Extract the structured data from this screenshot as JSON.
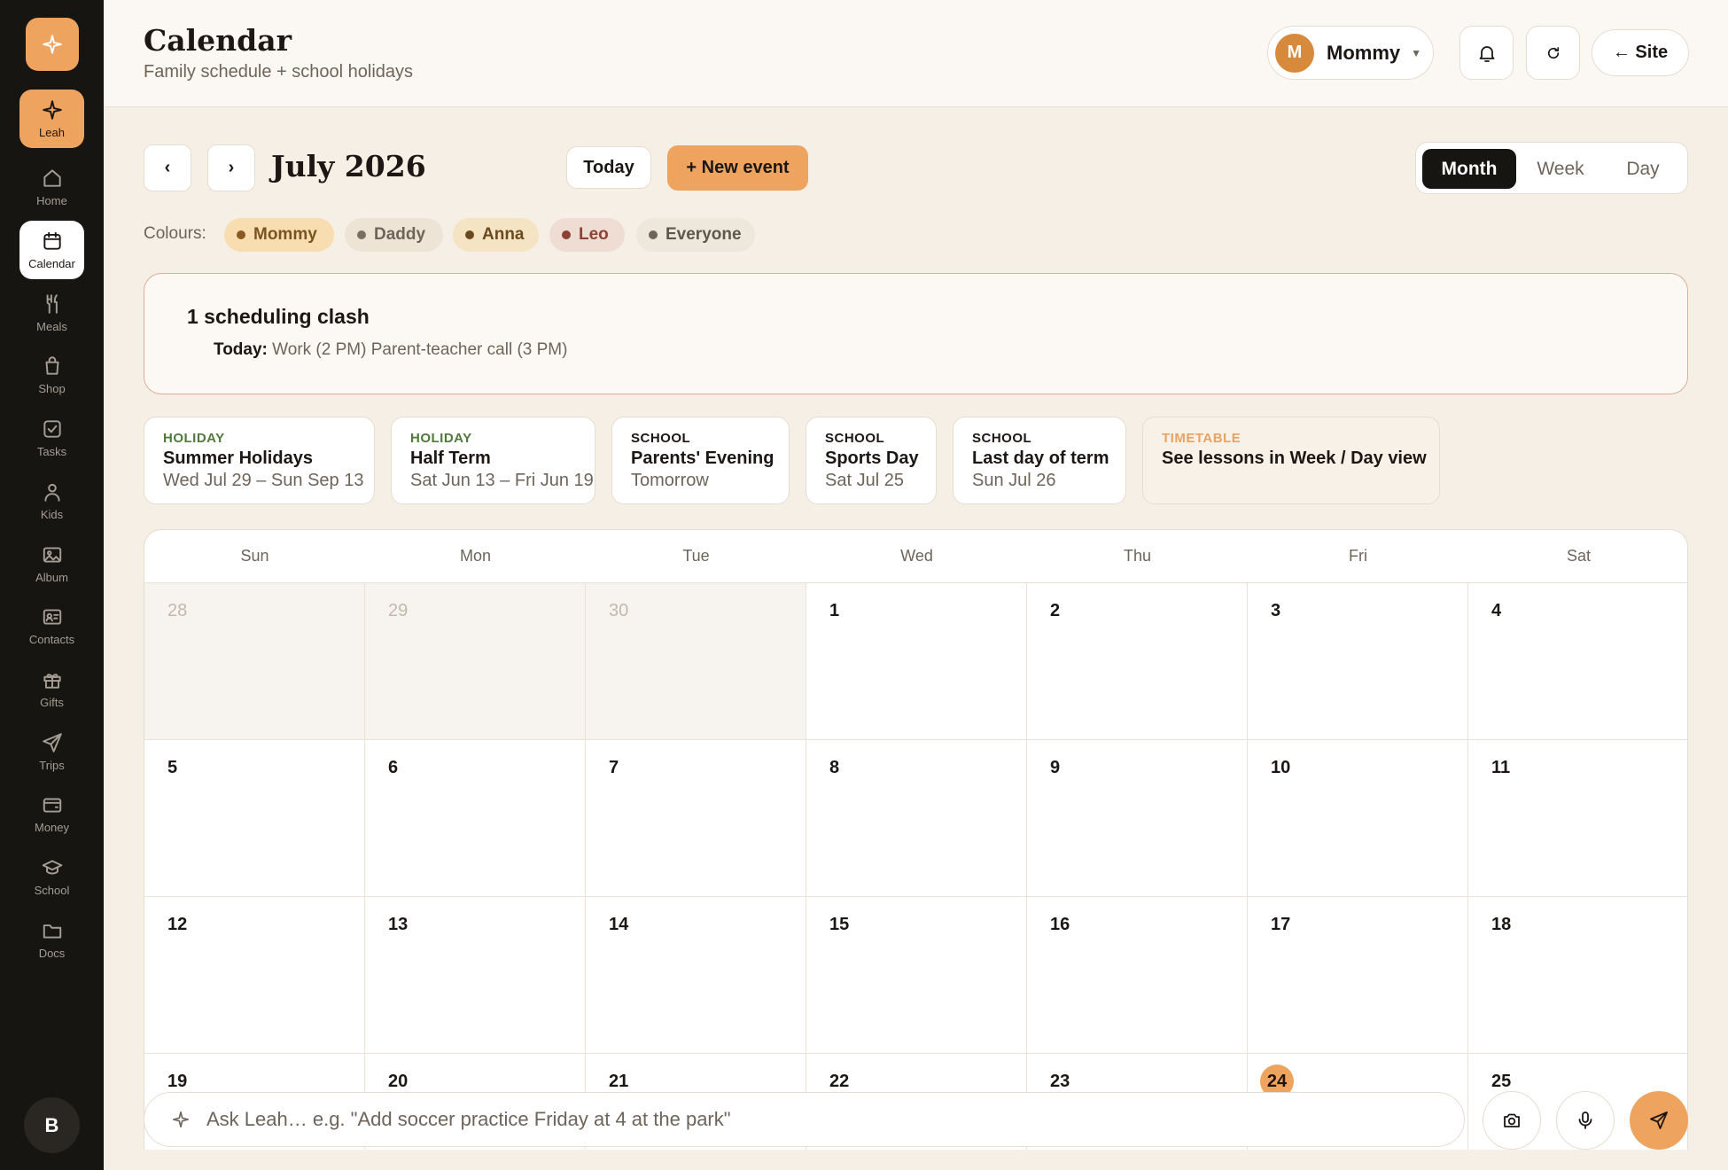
{
  "sidebar": {
    "items": [
      {
        "label": "Leah",
        "icon": "sparkle-icon"
      },
      {
        "label": "Home",
        "icon": "home-icon"
      },
      {
        "label": "Calendar",
        "icon": "calendar-icon"
      },
      {
        "label": "Meals",
        "icon": "utensils-icon"
      },
      {
        "label": "Shop",
        "icon": "shopping-bag-icon"
      },
      {
        "label": "Tasks",
        "icon": "checkbox-icon"
      },
      {
        "label": "Kids",
        "icon": "person-icon"
      },
      {
        "label": "Album",
        "icon": "image-icon"
      },
      {
        "label": "Contacts",
        "icon": "contact-card-icon"
      },
      {
        "label": "Gifts",
        "icon": "gift-icon"
      },
      {
        "label": "Trips",
        "icon": "paper-plane-icon"
      },
      {
        "label": "Money",
        "icon": "wallet-icon"
      },
      {
        "label": "School",
        "icon": "graduation-cap-icon"
      },
      {
        "label": "Docs",
        "icon": "folder-icon"
      }
    ],
    "avatar_initial": "B"
  },
  "header": {
    "title": "Calendar",
    "subtitle": "Family schedule + school holidays",
    "user_initial": "M",
    "user_name": "Mommy",
    "site_label": "← Site"
  },
  "toolbar": {
    "prev": "‹",
    "next": "›",
    "month_label": "July 2026",
    "today_label": "Today",
    "new_event_label": "+ New event",
    "views": [
      "Month",
      "Week",
      "Day"
    ],
    "active_view": "Month"
  },
  "legend": {
    "label": "Colours:",
    "chips": [
      {
        "name": "Mommy",
        "bg": "#f7ddb0",
        "dot": "#8a5a22",
        "color": "#7a5420"
      },
      {
        "name": "Daddy",
        "bg": "#eee4d6",
        "dot": "#7a7064",
        "color": "#6e645a"
      },
      {
        "name": "Anna",
        "bg": "#f4e4c4",
        "dot": "#6b4a1f",
        "color": "#6b4a1f"
      },
      {
        "name": "Leo",
        "bg": "#efdcd3",
        "dot": "#8a4336",
        "color": "#8a4336"
      },
      {
        "name": "Everyone",
        "bg": "#eee7dc",
        "dot": "#6e645a",
        "color": "#5f574e"
      }
    ]
  },
  "clash": {
    "title": "1 scheduling clash",
    "day": "Today:",
    "details": "Work (2 PM) Parent-teacher call (3 PM)"
  },
  "events": [
    {
      "kind": "HOLIDAY",
      "title": "Summer Holidays",
      "date": "Wed Jul 29 – Sun Sep 13",
      "kind_color": "#4f7a3a"
    },
    {
      "kind": "HOLIDAY",
      "title": "Half Term",
      "date": "Sat Jun 13 – Fri Jun 19",
      "kind_color": "#4f7a3a"
    },
    {
      "kind": "SCHOOL",
      "title": "Parents' Evening",
      "date": "Tomorrow",
      "kind_color": "#1c1714"
    },
    {
      "kind": "SCHOOL",
      "title": "Sports Day",
      "date": "Sat Jul 25",
      "kind_color": "#1c1714"
    },
    {
      "kind": "SCHOOL",
      "title": "Last day of term",
      "date": "Sun Jul 26",
      "kind_color": "#1c1714"
    },
    {
      "kind": "TIMETABLE",
      "title": "See lessons in Week / Day view",
      "date": "",
      "kind_color": "#e8a262"
    }
  ],
  "calendar": {
    "weekdays": [
      "Sun",
      "Mon",
      "Tue",
      "Wed",
      "Thu",
      "Fri",
      "Sat"
    ],
    "weeks": [
      [
        {
          "d": "28",
          "out": true
        },
        {
          "d": "29",
          "out": true
        },
        {
          "d": "30",
          "out": true
        },
        {
          "d": "1"
        },
        {
          "d": "2"
        },
        {
          "d": "3"
        },
        {
          "d": "4"
        }
      ],
      [
        {
          "d": "5"
        },
        {
          "d": "6"
        },
        {
          "d": "7"
        },
        {
          "d": "8"
        },
        {
          "d": "9"
        },
        {
          "d": "10"
        },
        {
          "d": "11"
        }
      ],
      [
        {
          "d": "12"
        },
        {
          "d": "13"
        },
        {
          "d": "14"
        },
        {
          "d": "15"
        },
        {
          "d": "16"
        },
        {
          "d": "17"
        },
        {
          "d": "18"
        }
      ],
      [
        {
          "d": "19"
        },
        {
          "d": "20"
        },
        {
          "d": "21"
        },
        {
          "d": "22"
        },
        {
          "d": "23"
        },
        {
          "d": "24",
          "today": true
        },
        {
          "d": "25"
        }
      ]
    ]
  },
  "ask": {
    "placeholder": "Ask Leah… e.g. \"Add soccer practice Friday at 4 at the park\""
  },
  "colors": {
    "accent": "#eea35f",
    "sidebar_bg": "#171512",
    "page_bg": "#f6efe5"
  }
}
